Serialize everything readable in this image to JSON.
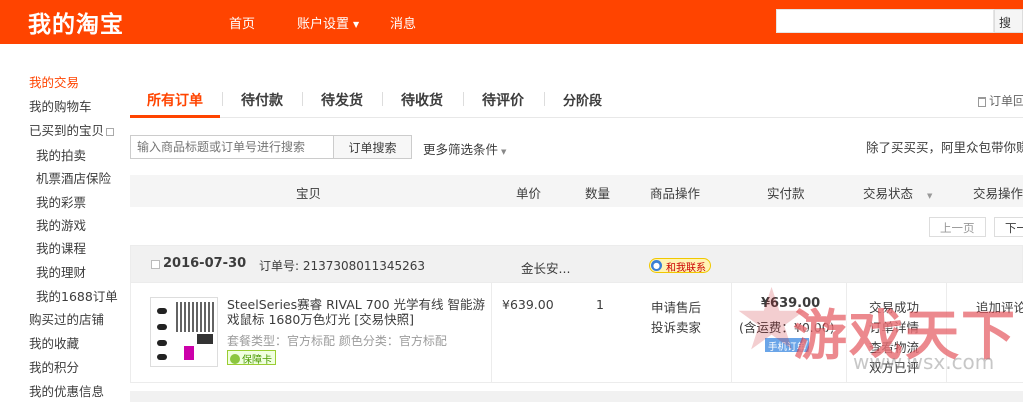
{
  "header": {
    "logo": "我的淘宝",
    "nav": [
      "首页",
      "账户设置",
      "消息"
    ],
    "search_button": "搜",
    "search_value": "",
    "brand_color": "#ff4400"
  },
  "sidebar": {
    "items": [
      {
        "label": "我的交易",
        "active": true
      },
      {
        "label": "我的购物车"
      },
      {
        "label": "已买到的宝贝"
      },
      {
        "label": "我的拍卖"
      },
      {
        "label": "机票酒店保险"
      },
      {
        "label": "我的彩票"
      },
      {
        "label": "我的游戏"
      },
      {
        "label": "我的课程"
      },
      {
        "label": "我的理财"
      },
      {
        "label": "我的1688订单"
      },
      {
        "label": "购买过的店铺"
      },
      {
        "label": "我的收藏"
      },
      {
        "label": "我的积分"
      },
      {
        "label": "我的优惠信息"
      }
    ]
  },
  "tabs": {
    "items": [
      "所有订单",
      "待付款",
      "待发货",
      "待收货",
      "待评价",
      "分阶段"
    ],
    "recycle": "订单回"
  },
  "search": {
    "placeholder": "输入商品标题或订单号进行搜索",
    "button": "订单搜索",
    "filters": "更多筛选条件",
    "promo": "除了买买买，阿里众包带你赚"
  },
  "table": {
    "columns": [
      "宝贝",
      "单价",
      "数量",
      "商品操作",
      "实付款",
      "交易状态",
      "交易操作"
    ],
    "pager": {
      "prev": "上一页",
      "next": "下一"
    }
  },
  "order": {
    "date": "2016-07-30",
    "order_no": "订单号: 2137308011345263",
    "shop": "金长安...",
    "chat": "和我联系",
    "item_title": "SteelSeries赛睿 RIVAL 700 光学有线 智能游戏鼠标 1680万色灯光 [交易快照]",
    "sku": "套餐类型：官方标配  颜色分类：官方标配",
    "guarantee": "保障卡",
    "price": "¥639.00",
    "qty": "1",
    "item_ops": [
      "申请售后",
      "投诉卖家"
    ],
    "paid": "¥639.00",
    "shipping": "(含运费：¥0.00)",
    "paid_via": "手机订单",
    "status": [
      "交易成功",
      "订单详情",
      "查看物流",
      "双方已评"
    ],
    "review": "追加评论"
  },
  "watermark": {
    "text": "游戏天下",
    "url": "www.wsx.com"
  }
}
